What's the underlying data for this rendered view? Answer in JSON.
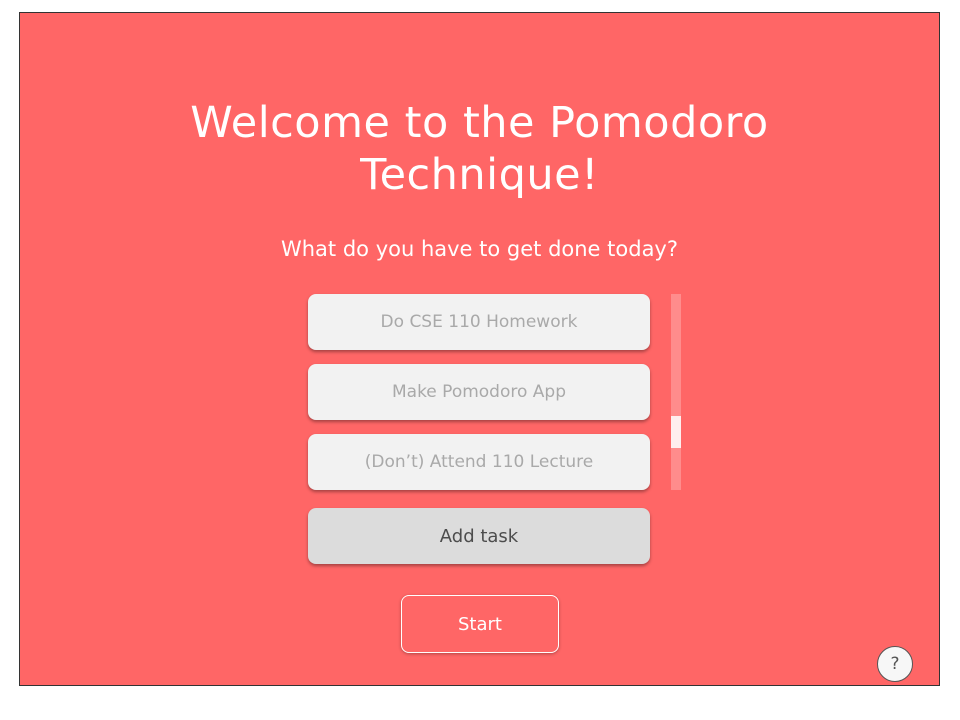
{
  "welcome": {
    "title_line1": "Welcome to the Pomodoro",
    "title_line2": "Technique!"
  },
  "prompt": "What do you have to get done today?",
  "tasks": [
    {
      "label": "Do CSE 110 Homework"
    },
    {
      "label": "Make Pomodoro App"
    },
    {
      "label": "(Don’t) Attend 110 Lecture"
    }
  ],
  "add_task_label": "Add task",
  "start_label": "Start",
  "help": {
    "label": "?",
    "icon": "question-mark-icon"
  },
  "colors": {
    "background": "#ff6666",
    "task_background": "#f2f2f2",
    "task_text": "#a9a9a9",
    "add_task_background": "#dcdcdc",
    "text": "#ffffff"
  }
}
